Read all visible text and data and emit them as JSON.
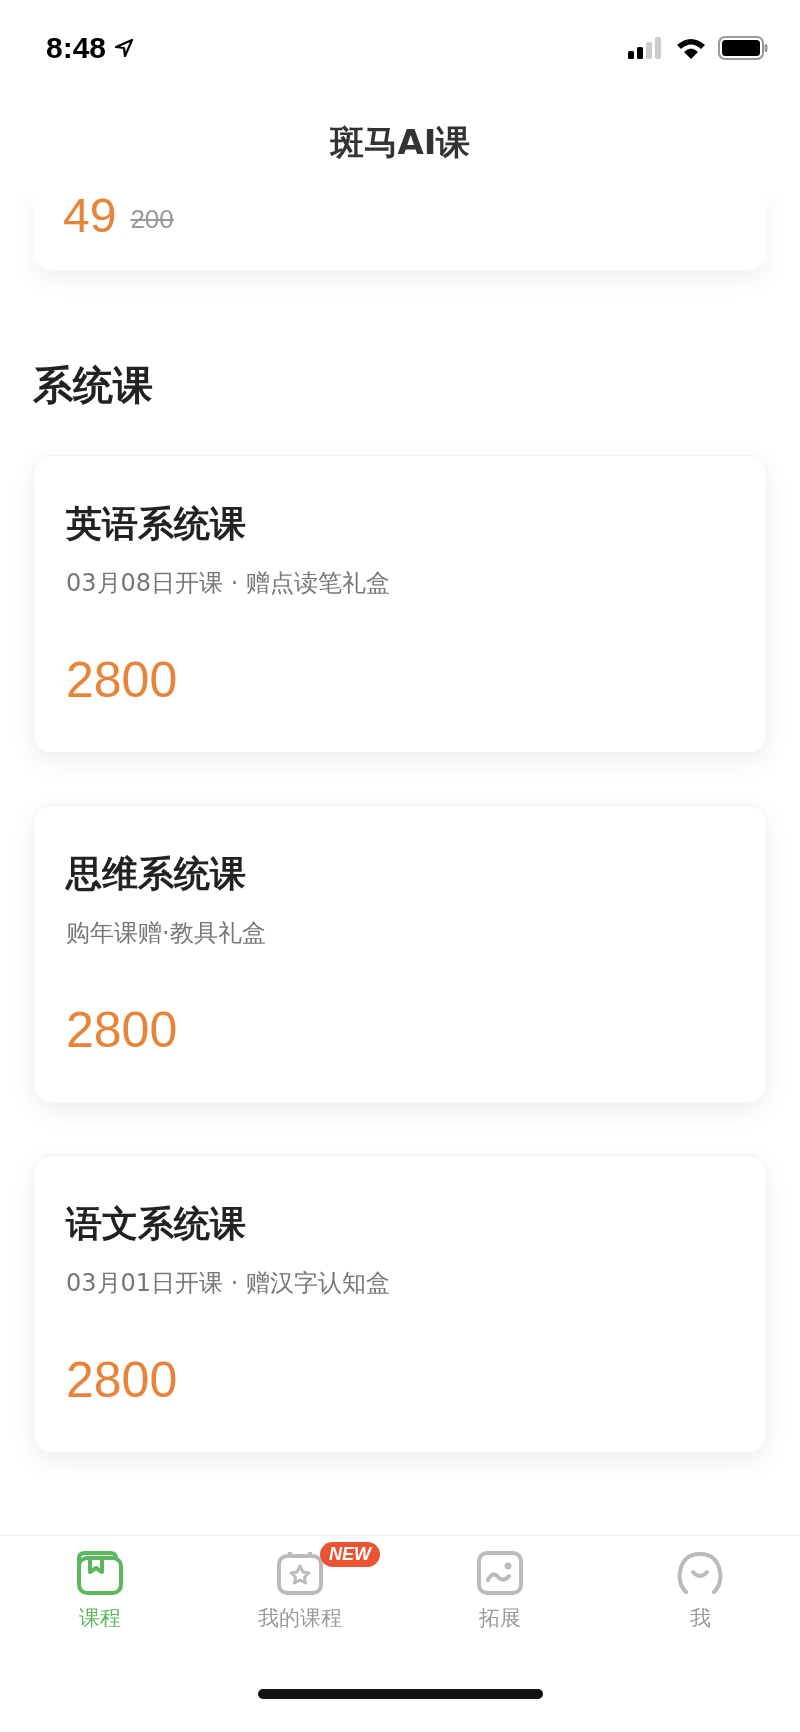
{
  "status_bar": {
    "time": "8:48"
  },
  "header": {
    "title": "斑马AI课"
  },
  "partial_card": {
    "price": "49",
    "original_price": "200"
  },
  "section": {
    "title": "系统课"
  },
  "courses": [
    {
      "title": "英语系统课",
      "subtitle": "03月08日开课 · 赠点读笔礼盒",
      "price": "2800"
    },
    {
      "title": "思维系统课",
      "subtitle": "购年课赠·教具礼盒",
      "price": "2800"
    },
    {
      "title": "语文系统课",
      "subtitle": "03月01日开课 · 赠汉字认知盒",
      "price": "2800"
    }
  ],
  "tabs": [
    {
      "label": "课程",
      "kind": "book",
      "selected": true
    },
    {
      "label": "我的课程",
      "kind": "calendar",
      "selected": false,
      "badge": "NEW"
    },
    {
      "label": "拓展",
      "kind": "picture-frame",
      "selected": false
    },
    {
      "label": "我",
      "kind": "face",
      "selected": false
    }
  ]
}
